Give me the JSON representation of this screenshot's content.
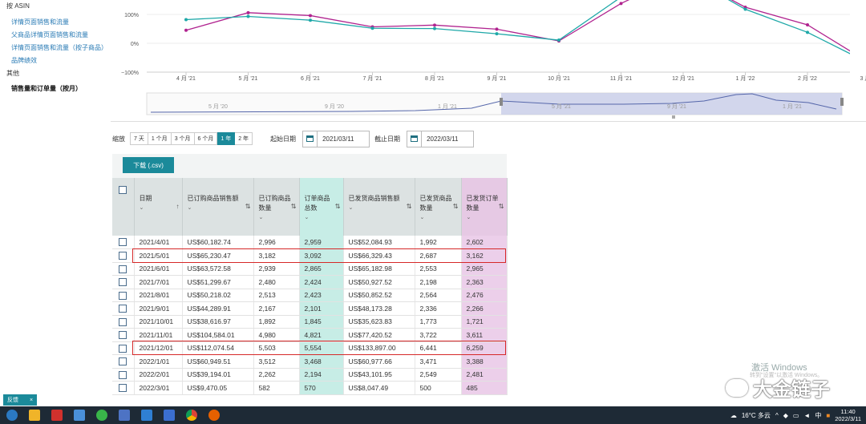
{
  "sidebar": {
    "heading": "按 ASIN",
    "links": [
      "详情页面销售和流量",
      "父商品详情页面销售和流量",
      "详情页面销售和流量（按子商品）",
      "品牌绩效"
    ],
    "category": "其他",
    "active": "销售量和订单量（按月）"
  },
  "chart": {
    "y_ticks": [
      "100%",
      "0%",
      "−100%"
    ],
    "x_ticks": [
      "4 月 '21",
      "5 月 '21",
      "6 月 '21",
      "7 月 '21",
      "8 月 '21",
      "9 月 '21",
      "10 月 '21",
      "11 月 '21",
      "12 月 '21",
      "1 月 '22",
      "2 月 '22",
      "3 月 '22"
    ],
    "navigator_ticks": [
      "5 月 '20",
      "9 月 '20",
      "1 月 '21",
      "5 月 '21",
      "9 月 '21",
      "1 月 '21"
    ],
    "colors": {
      "series_a": "#b0238f",
      "series_b": "#1ea8a8"
    }
  },
  "chart_data": {
    "type": "line",
    "x": [
      "4 月 '21",
      "5 月 '21",
      "6 月 '21",
      "7 月 '21",
      "8 月 '21",
      "9 月 '21",
      "10 月 '21",
      "11 月 '21",
      "12 月 '21",
      "1 月 '22",
      "2 月 '22",
      "3 月 '22"
    ],
    "series": [
      {
        "values": [
          45,
          106,
          96,
          57,
          63,
          49,
          8,
          138,
          null,
          125,
          64,
          -68
        ]
      },
      {
        "values": [
          82,
          93,
          80,
          52,
          51,
          33,
          11,
          160,
          null,
          118,
          38,
          -70
        ]
      }
    ],
    "ylim": [
      -100,
      150
    ]
  },
  "controls": {
    "zoom_label": "缩放",
    "zoom_options": [
      "7 天",
      "1 个月",
      "3 个月",
      "6 个月",
      "1 年",
      "2 年"
    ],
    "zoom_active": 4,
    "start_label": "起始日期",
    "start_date": "2021/03/11",
    "end_label": "截止日期",
    "end_date": "2022/03/11"
  },
  "download": {
    "label": "下载 (.csv)"
  },
  "table": {
    "headers": [
      {
        "lines": [
          "日期"
        ],
        "sort": "↑"
      },
      {
        "lines": [
          "已订购商品销售额"
        ],
        "sort": "⇅"
      },
      {
        "lines": [
          "已订购商品",
          "数量"
        ],
        "sort": "⇅"
      },
      {
        "lines": [
          "订单商品",
          "总数"
        ],
        "sort": "⇅"
      },
      {
        "lines": [
          "已发货商品销售额"
        ],
        "sort": "⇅"
      },
      {
        "lines": [
          "已发货商品",
          "数量"
        ],
        "sort": "⇅"
      },
      {
        "lines": [
          "已发货订单",
          "数量"
        ],
        "sort": "⇅"
      }
    ],
    "rows": [
      [
        "2021/4/01",
        "US$60,182.74",
        "2,996",
        "2,959",
        "US$52,084.93",
        "1,992",
        "2,602"
      ],
      [
        "2021/5/01",
        "US$65,230.47",
        "3,182",
        "3,092",
        "US$66,329.43",
        "2,687",
        "3,162"
      ],
      [
        "2021/6/01",
        "US$63,572.58",
        "2,939",
        "2,865",
        "US$65,182.98",
        "2,553",
        "2,965"
      ],
      [
        "2021/7/01",
        "US$51,299.67",
        "2,480",
        "2,424",
        "US$50,927.52",
        "2,198",
        "2,363"
      ],
      [
        "2021/8/01",
        "US$50,218.02",
        "2,513",
        "2,423",
        "US$50,852.52",
        "2,564",
        "2,476"
      ],
      [
        "2021/9/01",
        "US$44,289.91",
        "2,167",
        "2,101",
        "US$48,173.28",
        "2,336",
        "2,266"
      ],
      [
        "2021/10/01",
        "US$38,616.97",
        "1,892",
        "1,845",
        "US$35,623.83",
        "1,773",
        "1,721"
      ],
      [
        "2021/11/01",
        "US$104,584.01",
        "4,980",
        "4,821",
        "US$77,420.52",
        "3,722",
        "3,611"
      ],
      [
        "2021/12/01",
        "US$112,074.54",
        "5,503",
        "5,554",
        "US$133,897.00",
        "6,441",
        "6,259"
      ],
      [
        "2022/1/01",
        "US$60,949.51",
        "3,512",
        "3,468",
        "US$60,977.66",
        "3,471",
        "3,388"
      ],
      [
        "2022/2/01",
        "US$39,194.01",
        "2,262",
        "2,194",
        "US$43,101.95",
        "2,549",
        "2,481"
      ],
      [
        "2022/3/01",
        "US$9,470.05",
        "582",
        "570",
        "US$8,047.49",
        "500",
        "485"
      ]
    ],
    "highlighted_rows": [
      1,
      8
    ]
  },
  "feedback": {
    "label": "反馈",
    "close": "×"
  },
  "watermark": {
    "activate": "激活 Windows",
    "sub": "转到\"设置\"以激活 Windows。",
    "brand": "大金链子"
  },
  "taskbar": {
    "weather": "16°C 多云",
    "ime": "中",
    "time": "11:40",
    "date": "2022/3/11"
  }
}
